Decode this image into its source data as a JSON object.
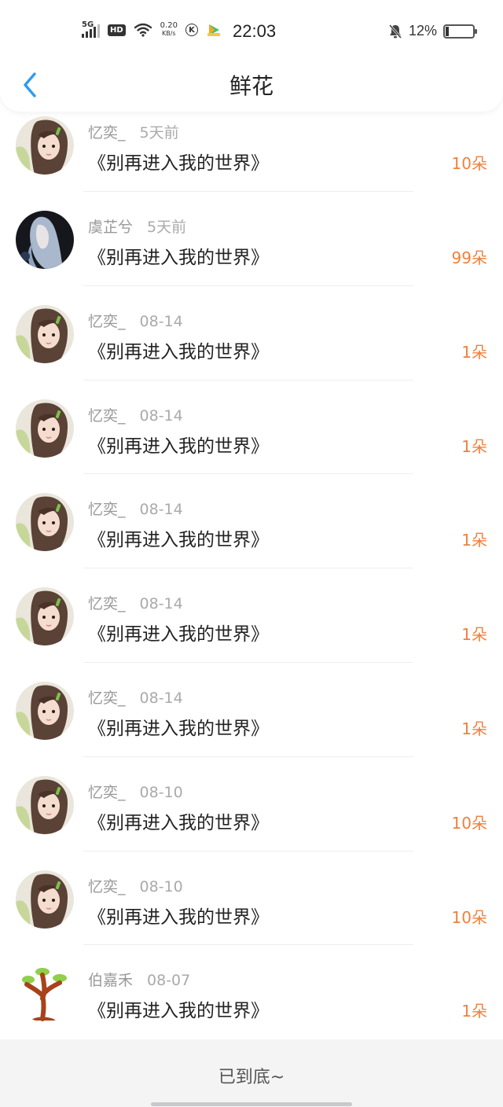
{
  "status_bar": {
    "network": "5G",
    "hd": "HD",
    "speed_value": "0.20",
    "speed_unit": "KB/s",
    "k_label": "K",
    "time": "22:03",
    "battery_text": "12%",
    "battery_level": 0.12
  },
  "nav": {
    "title": "鲜花"
  },
  "records": [
    {
      "name": "忆奕_",
      "time": "5天前",
      "title": "《别再进入我的世界》",
      "count": "10朵",
      "avatar": "girl"
    },
    {
      "name": "虞芷兮",
      "time": "5天前",
      "title": "《别再进入我的世界》",
      "count": "99朵",
      "avatar": "dark"
    },
    {
      "name": "忆奕_",
      "time": "08-14",
      "title": "《别再进入我的世界》",
      "count": "1朵",
      "avatar": "girl"
    },
    {
      "name": "忆奕_",
      "time": "08-14",
      "title": "《别再进入我的世界》",
      "count": "1朵",
      "avatar": "girl"
    },
    {
      "name": "忆奕_",
      "time": "08-14",
      "title": "《别再进入我的世界》",
      "count": "1朵",
      "avatar": "girl"
    },
    {
      "name": "忆奕_",
      "time": "08-14",
      "title": "《别再进入我的世界》",
      "count": "1朵",
      "avatar": "girl"
    },
    {
      "name": "忆奕_",
      "time": "08-14",
      "title": "《别再进入我的世界》",
      "count": "1朵",
      "avatar": "girl"
    },
    {
      "name": "忆奕_",
      "time": "08-10",
      "title": "《别再进入我的世界》",
      "count": "10朵",
      "avatar": "girl"
    },
    {
      "name": "忆奕_",
      "time": "08-10",
      "title": "《别再进入我的世界》",
      "count": "10朵",
      "avatar": "girl"
    },
    {
      "name": "伯嘉禾",
      "time": "08-07",
      "title": "《别再进入我的世界》",
      "count": "1朵",
      "avatar": "tree"
    }
  ],
  "footer": {
    "end_text": "已到底~"
  },
  "colors": {
    "accent_blue": "#2f9bf0",
    "count_orange": "#f0803c"
  }
}
